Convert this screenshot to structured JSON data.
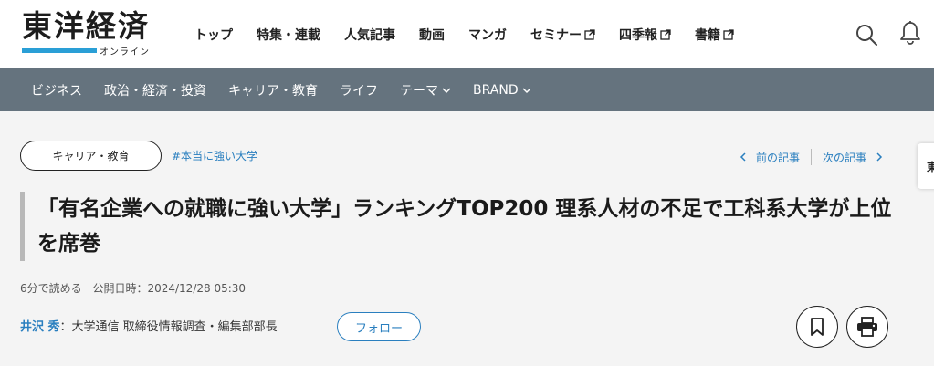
{
  "header": {
    "logo_main": "東洋経済",
    "logo_sub": "オンライン",
    "nav": [
      {
        "label": "トップ",
        "external": false
      },
      {
        "label": "特集・連載",
        "external": false
      },
      {
        "label": "人気記事",
        "external": false
      },
      {
        "label": "動画",
        "external": false
      },
      {
        "label": "マンガ",
        "external": false
      },
      {
        "label": "セミナー",
        "external": true
      },
      {
        "label": "四季報",
        "external": true
      },
      {
        "label": "書籍",
        "external": true
      }
    ],
    "icons": [
      "search-icon",
      "bell-icon",
      "external-link-icon"
    ]
  },
  "category_bar": {
    "items": [
      {
        "label": "ビジネス"
      },
      {
        "label": "政治・経済・投資"
      },
      {
        "label": "キャリア・教育"
      },
      {
        "label": "ライフ"
      },
      {
        "label": "テーマ"
      },
      {
        "label": "BRAND"
      }
    ]
  },
  "article": {
    "category_tag": "キャリア・教育",
    "hashtag": "#本当に強い大学",
    "prev_label": "前の記事",
    "next_label": "次の記事",
    "side_tab": "東",
    "title": "「有名企業への就職に強い大学」ランキングTOP200 理系人材の不足で工科系大学が上位を席巻",
    "reading_time": "6分で読める",
    "published": "公開日時：2024/12/28 05:30",
    "author_name": "井沢 秀",
    "author_affiliation": "：大学通信 取締役情報調査・編集部部長",
    "follow_label": "フォロー"
  },
  "colors": {
    "accent_blue": "#2a7fbf",
    "category_bar_bg": "#65737e",
    "logo_bar": "#2a9fd6"
  }
}
